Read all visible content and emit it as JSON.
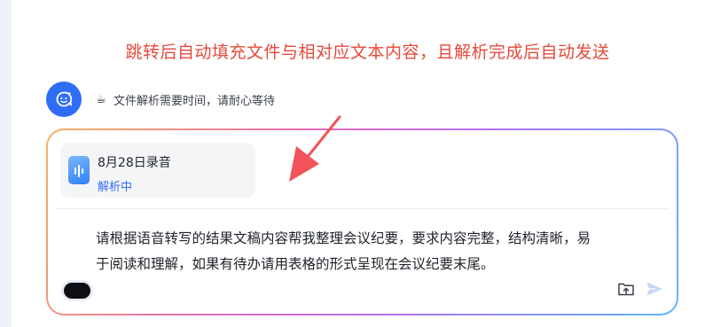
{
  "annotation": {
    "text": "跳转后自动填充文件与相对应文本内容，且解析完成后自动发送"
  },
  "status": {
    "avatar_icon": "bot-face-icon",
    "coffee_icon": "☕",
    "text": "文件解析需要时间，请耐心等待"
  },
  "file_card": {
    "icon": "audio-file-icon",
    "name": "8月28日录音",
    "status": "解析中"
  },
  "composer": {
    "message": "请根据语音转写的结果文稿内容帮我整理会议纪要，要求内容完整，结构清晰，易于阅读和理解，如果有待办请用表格的形式呈现在会议纪要末尾。",
    "mic_icon": "voice-input-icon",
    "upload_icon": "upload-file-icon",
    "send_icon": "send-icon"
  },
  "colors": {
    "annotation": "#e64a3b",
    "accent": "#2f6df6",
    "arrow": "#f2545b"
  }
}
